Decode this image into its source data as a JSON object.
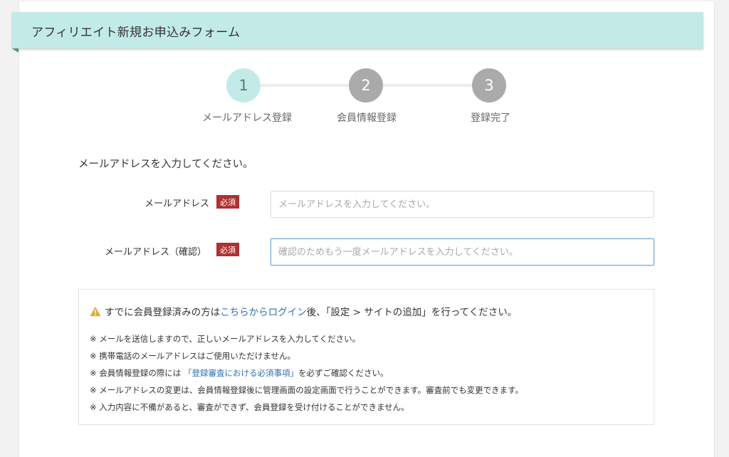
{
  "header": {
    "title": "アフィリエイト新規お申込みフォーム",
    "accent_color": "#c2ebe7"
  },
  "stepper": {
    "current_step": 1,
    "steps": [
      {
        "number": "1",
        "label": "メールアドレス登録",
        "state": "active"
      },
      {
        "number": "2",
        "label": "会員情報登録",
        "state": "inactive"
      },
      {
        "number": "3",
        "label": "登録完了",
        "state": "inactive"
      }
    ]
  },
  "form": {
    "instruction": "メールアドレスを入力してください。",
    "required_label": "必須",
    "email": {
      "label": "メールアドレス",
      "value": "",
      "placeholder": "メールアドレスを入力してください。"
    },
    "email_confirm": {
      "label": "メールアドレス（確認）",
      "value": "",
      "placeholder": "確認のためもう一度メールアドレスを入力してください。"
    }
  },
  "notice": {
    "icon": "warning-icon",
    "lead_before": "すでに会員登録済みの方は",
    "lead_link": "こちらからログイン",
    "lead_after": "後、「設定 > サイトの追加」を行ってください。",
    "notes": {
      "n1": "※ メールを送信しますので、正しいメールアドレスを入力してください。",
      "n2": "※ 携帯電話のメールアドレスはご使用いただけません。",
      "n3_before": "※ 会員情報登録の際には",
      "n3_link": "「登録審査における必須事項」",
      "n3_after": "を必ずご確認ください。",
      "n4": "※ メールアドレスの変更は、会員情報登録後に管理画面の設定画面で行うことができます。審査前でも変更できます。",
      "n5": "※ 入力内容に不備があると、審査ができず、会員登録を受け付けることができません。"
    },
    "link_color": "#2f6fb6"
  }
}
